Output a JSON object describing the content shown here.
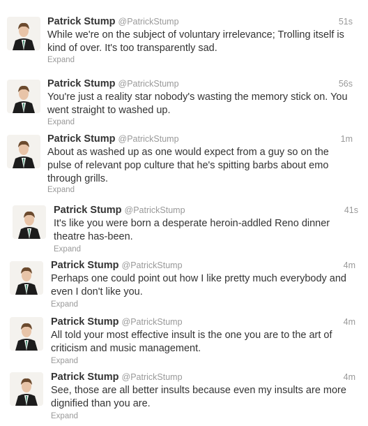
{
  "tweets": [
    {
      "name": "Patrick Stump",
      "handle": "@PatrickStump",
      "time": "51s",
      "text": "While we're on the subject of voluntary irrelevance; Trolling itself is\nkind of over. It's too transparently sad.",
      "expand": "Expand"
    },
    {
      "name": "Patrick Stump",
      "handle": "@PatrickStump",
      "time": "56s",
      "text": "You're just a reality star nobody's wasting the memory stick on. You\nwent straight to washed up.",
      "expand": "Expand"
    },
    {
      "name": "Patrick Stump",
      "handle": "@PatrickStump",
      "time": "1m",
      "text": "About as washed up as one would expect from a guy so on the\npulse of relevant pop culture that he's spitting barbs about emo\nthrough grills.",
      "expand": "Expand"
    },
    {
      "name": "Patrick Stump",
      "handle": "@PatrickStump",
      "time": "41s",
      "text": "It's like you were born a desperate heroin-addled Reno dinner\ntheatre has-been.",
      "expand": "Expand"
    },
    {
      "name": "Patrick Stump",
      "handle": "@PatrickStump",
      "time": "4m",
      "text": "Perhaps one could point out how I like pretty much everybody and\neven I don't like you.",
      "expand": "Expand"
    },
    {
      "name": "Patrick Stump",
      "handle": "@PatrickStump",
      "time": "4m",
      "text": "All told your most effective insult is the one you are to the art of\ncriticism and music management.",
      "expand": "Expand"
    },
    {
      "name": "Patrick Stump",
      "handle": "@PatrickStump",
      "time": "4m",
      "text": "See, those are all better insults because even my insults are more\ndignified than you are.",
      "expand": "Expand"
    }
  ]
}
